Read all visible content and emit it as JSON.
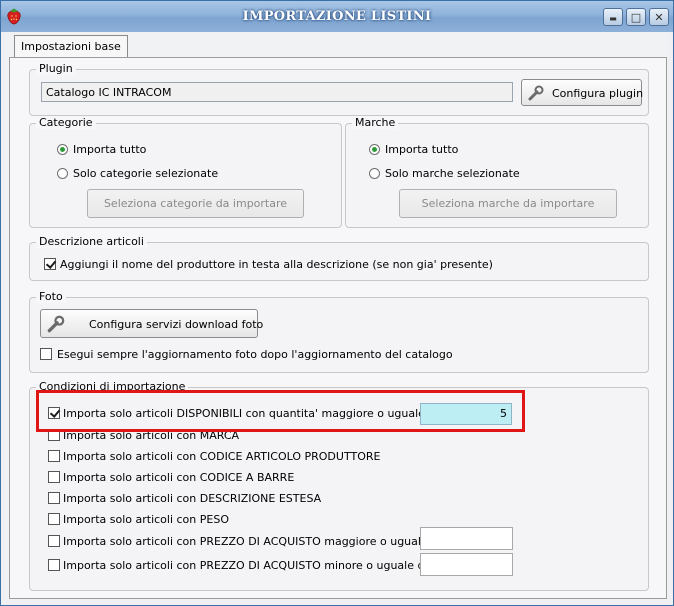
{
  "window": {
    "title": "IMPORTAZIONE LISTINI",
    "icon": "strawberry-icon",
    "controls": {
      "minimize": "▬",
      "maximize": "□",
      "close": "✕"
    }
  },
  "tabs": [
    {
      "label": "Impostazioni base",
      "active": true
    }
  ],
  "plugin": {
    "group_label": "Plugin",
    "value": "Catalogo IC INTRACOM",
    "configure_button": "Configura plugin",
    "configure_icon": "wrench-icon"
  },
  "categorie": {
    "group_label": "Categorie",
    "option_all": "Importa tutto",
    "option_selected": "Solo categorie selezionate",
    "selected_option": "all",
    "select_button": "Seleziona categorie da importare"
  },
  "marche": {
    "group_label": "Marche",
    "option_all": "Importa tutto",
    "option_selected": "Solo marche selezionate",
    "selected_option": "all",
    "select_button": "Seleziona marche da importare"
  },
  "descrizione": {
    "group_label": "Descrizione articoli",
    "checkbox_label": "Aggiungi il nome del produttore in testa alla descrizione (se non gia' presente)",
    "checked": true
  },
  "foto": {
    "group_label": "Foto",
    "configure_button": "Configura servizi download foto",
    "configure_icon": "wrench-icon",
    "checkbox_label": "Esegui sempre l'aggiornamento foto dopo l'aggiornamento del catalogo",
    "checked": false
  },
  "condizioni": {
    "group_label": "Condizioni di importazione",
    "items": [
      {
        "label": "Importa solo articoli DISPONIBILI con quantita' maggiore o uguale a :",
        "checked": true,
        "value": "5"
      },
      {
        "label": "Importa solo articoli con MARCA",
        "checked": false
      },
      {
        "label": "Importa solo articoli con CODICE ARTICOLO PRODUTTORE",
        "checked": false
      },
      {
        "label": "Importa solo articoli con CODICE A BARRE",
        "checked": false
      },
      {
        "label": "Importa solo articoli con DESCRIZIONE ESTESA",
        "checked": false
      },
      {
        "label": "Importa solo articoli con PESO",
        "checked": false
      },
      {
        "label": "Importa solo articoli con PREZZO DI ACQUISTO maggiore o uguale di :",
        "checked": false,
        "value": ""
      },
      {
        "label": "Importa solo articoli con PREZZO DI ACQUISTO minore o uguale di :",
        "checked": false,
        "value": ""
      }
    ]
  },
  "colors": {
    "highlight": "#e01515",
    "quantity_field": "#bdeef4",
    "title_bar": "#8eb2da"
  }
}
